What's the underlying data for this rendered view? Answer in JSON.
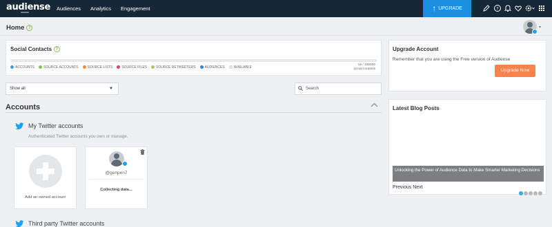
{
  "app": {
    "logo": "audiense"
  },
  "nav": {
    "items": [
      "Audiences",
      "Analytics",
      "Engagement"
    ],
    "upgrade_label": "UPGRADE"
  },
  "header": {
    "title": "Home"
  },
  "social_contacts": {
    "title": "Social Contacts",
    "legend": [
      {
        "label": "ACCOUNTS",
        "color": "#3aa3d8"
      },
      {
        "label": "SOURCE ACCOUNTS",
        "color": "#8cc152"
      },
      {
        "label": "SOURCE LISTS",
        "color": "#f28b3c"
      },
      {
        "label": "SOURCE FILES",
        "color": "#d9417a"
      },
      {
        "label": "SOURCE RETWEETERS",
        "color": "#a8c94a"
      },
      {
        "label": "AUDIENCES",
        "color": "#3a7dd8"
      },
      {
        "label": "AVAILABLE",
        "color": "#e6e8ea"
      }
    ],
    "count": "15 / 100000",
    "count_label": "social contacts"
  },
  "filters": {
    "select_value": "Show all",
    "search_placeholder": "Search"
  },
  "accounts": {
    "title": "Accounts",
    "my_twitter": {
      "title": "My Twitter accounts",
      "description": "Authenticated Twitter accounts you own or manage."
    },
    "add_card_label": "Add an owned account",
    "account_card": {
      "handle": "@genpen7",
      "status": "Collecting data..."
    },
    "third_party_title": "Third party Twitter accounts"
  },
  "upgrade_panel": {
    "title": "Upgrade Account",
    "text": "Remember that you are using the Free version of Audiense",
    "button_label": "Upgrade Now"
  },
  "blog_panel": {
    "title": "Latest Blog Posts",
    "caption": "Unlocking the Power of Audience Data to Make Smarter Marketing Decisions",
    "previous_label": "Previous",
    "next_label": "Next"
  },
  "colors": {
    "topbar": "#162838",
    "upgrade_blue": "#1b8fe0",
    "accent_orange": "#f5844c",
    "twitter_blue": "#1da1f2"
  }
}
